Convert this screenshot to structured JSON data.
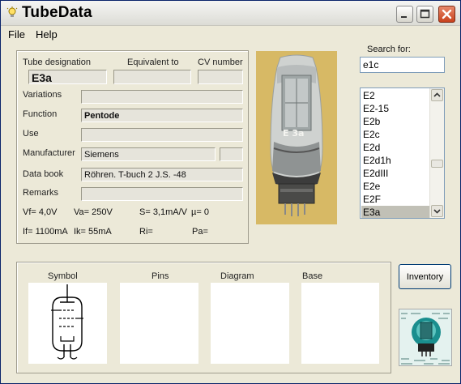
{
  "window": {
    "title": "TubeData"
  },
  "menu": {
    "file": "File",
    "help": "Help"
  },
  "tube": {
    "designation_label": "Tube designation",
    "designation": "E3a",
    "equivalent_label": "Equivalent to",
    "equivalent": "",
    "cv_label": "CV number",
    "cv": "",
    "variations_label": "Variations",
    "variations": "",
    "function_label": "Function",
    "function": "Pentode",
    "use_label": "Use",
    "use": "",
    "manufacturer_label": "Manufacturer",
    "manufacturer": "Siemens",
    "manufacturer_extra": "",
    "databook_label": "Data book",
    "databook": "Röhren. T-buch 2 J.S. -48",
    "remarks_label": "Remarks",
    "remarks": ""
  },
  "specs": {
    "vf": "Vf= 4,0V",
    "va": "Va= 250V",
    "s": "S= 3,1mA/V",
    "mu": "µ=   0",
    "if": "If= 1100mA",
    "ik": "Ik=   55mA",
    "ri": "Ri=",
    "pa": "Pa="
  },
  "search": {
    "label": "Search for:",
    "value": "e1c"
  },
  "tube_list": {
    "items": [
      "E2",
      "E2-15",
      "E2b",
      "E2c",
      "E2d",
      "E2d1h",
      "E2dIII",
      "E2e",
      "E2F",
      "E3a"
    ],
    "selected": "E3a"
  },
  "sections": {
    "symbol": "Symbol",
    "pins": "Pins",
    "diagram": "Diagram",
    "base": "Base"
  },
  "buttons": {
    "inventory": "Inventory"
  },
  "photo": {
    "label": "E 3a"
  },
  "colors": {
    "selection": "#c1c0b6",
    "window_bg": "#ece9d8",
    "close": "#c8401c"
  },
  "icons": {
    "app": "lightbulb-icon",
    "minimize": "minimize-icon",
    "maximize": "maximize-icon",
    "close": "close-icon"
  }
}
